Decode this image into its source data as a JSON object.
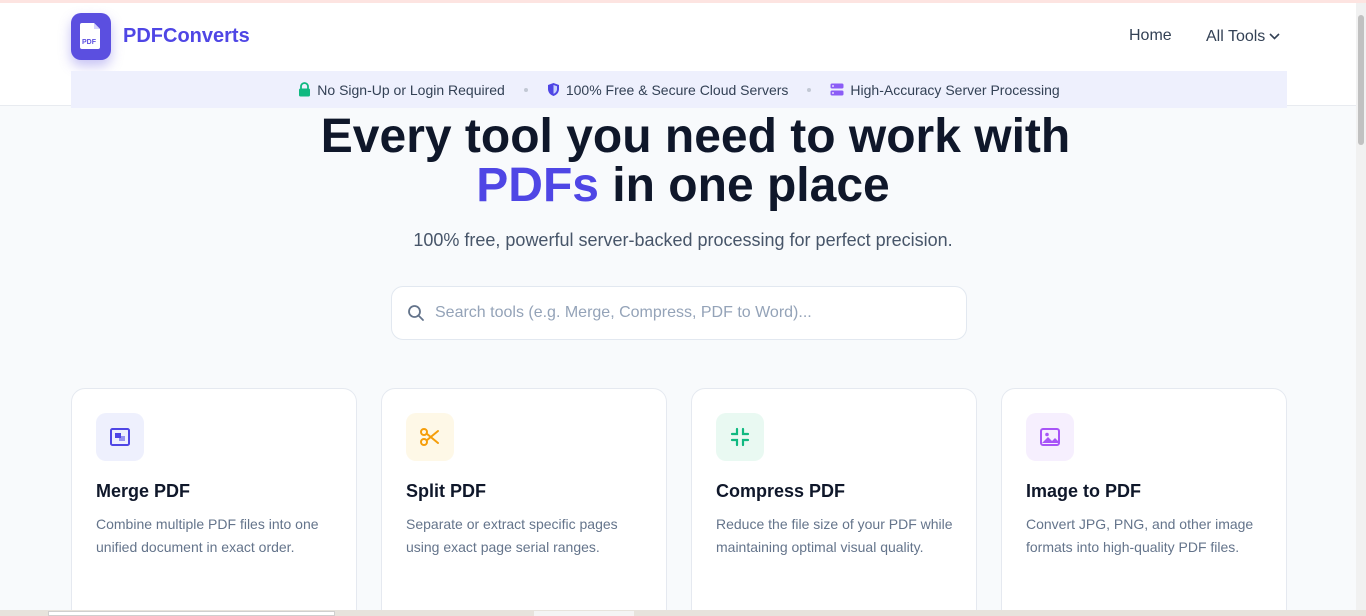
{
  "brand": {
    "name": "PDFConverts",
    "logo_text": "PDF",
    "accent_color": "#4f46e5"
  },
  "nav": {
    "home": "Home",
    "all_tools": "All Tools"
  },
  "features": [
    {
      "icon": "lock-icon",
      "label": "No Sign-Up or Login Required",
      "color": "#10b981"
    },
    {
      "icon": "shield-icon",
      "label": "100% Free & Secure Cloud Servers",
      "color": "#4f46e5"
    },
    {
      "icon": "server-icon",
      "label": "High-Accuracy Server Processing",
      "color": "#8b5cf6"
    }
  ],
  "hero": {
    "line1": "Every tool you need to work with",
    "accent": "PDFs",
    "line2_rest": " in one place",
    "subtitle": "100% free, powerful server-backed processing for perfect precision."
  },
  "search": {
    "placeholder": "Search tools (e.g. Merge, Compress, PDF to Word)..."
  },
  "tools": [
    {
      "title": "Merge PDF",
      "desc": "Combine multiple PDF files into one unified document in exact order.",
      "icon": "merge-icon",
      "color": "#4f46e5",
      "bg": "#eef0fd"
    },
    {
      "title": "Split PDF",
      "desc": "Separate or extract specific pages using exact page serial ranges.",
      "icon": "scissors-icon",
      "color": "#f59e0b",
      "bg": "#fef8e7"
    },
    {
      "title": "Compress PDF",
      "desc": "Reduce the file size of your PDF while maintaining optimal visual quality.",
      "icon": "compress-icon",
      "color": "#10b981",
      "bg": "#e9f9f2"
    },
    {
      "title": "Image to PDF",
      "desc": "Convert JPG, PNG, and other image formats into high-quality PDF files.",
      "icon": "image-icon",
      "color": "#a855f7",
      "bg": "#f6effe"
    }
  ]
}
